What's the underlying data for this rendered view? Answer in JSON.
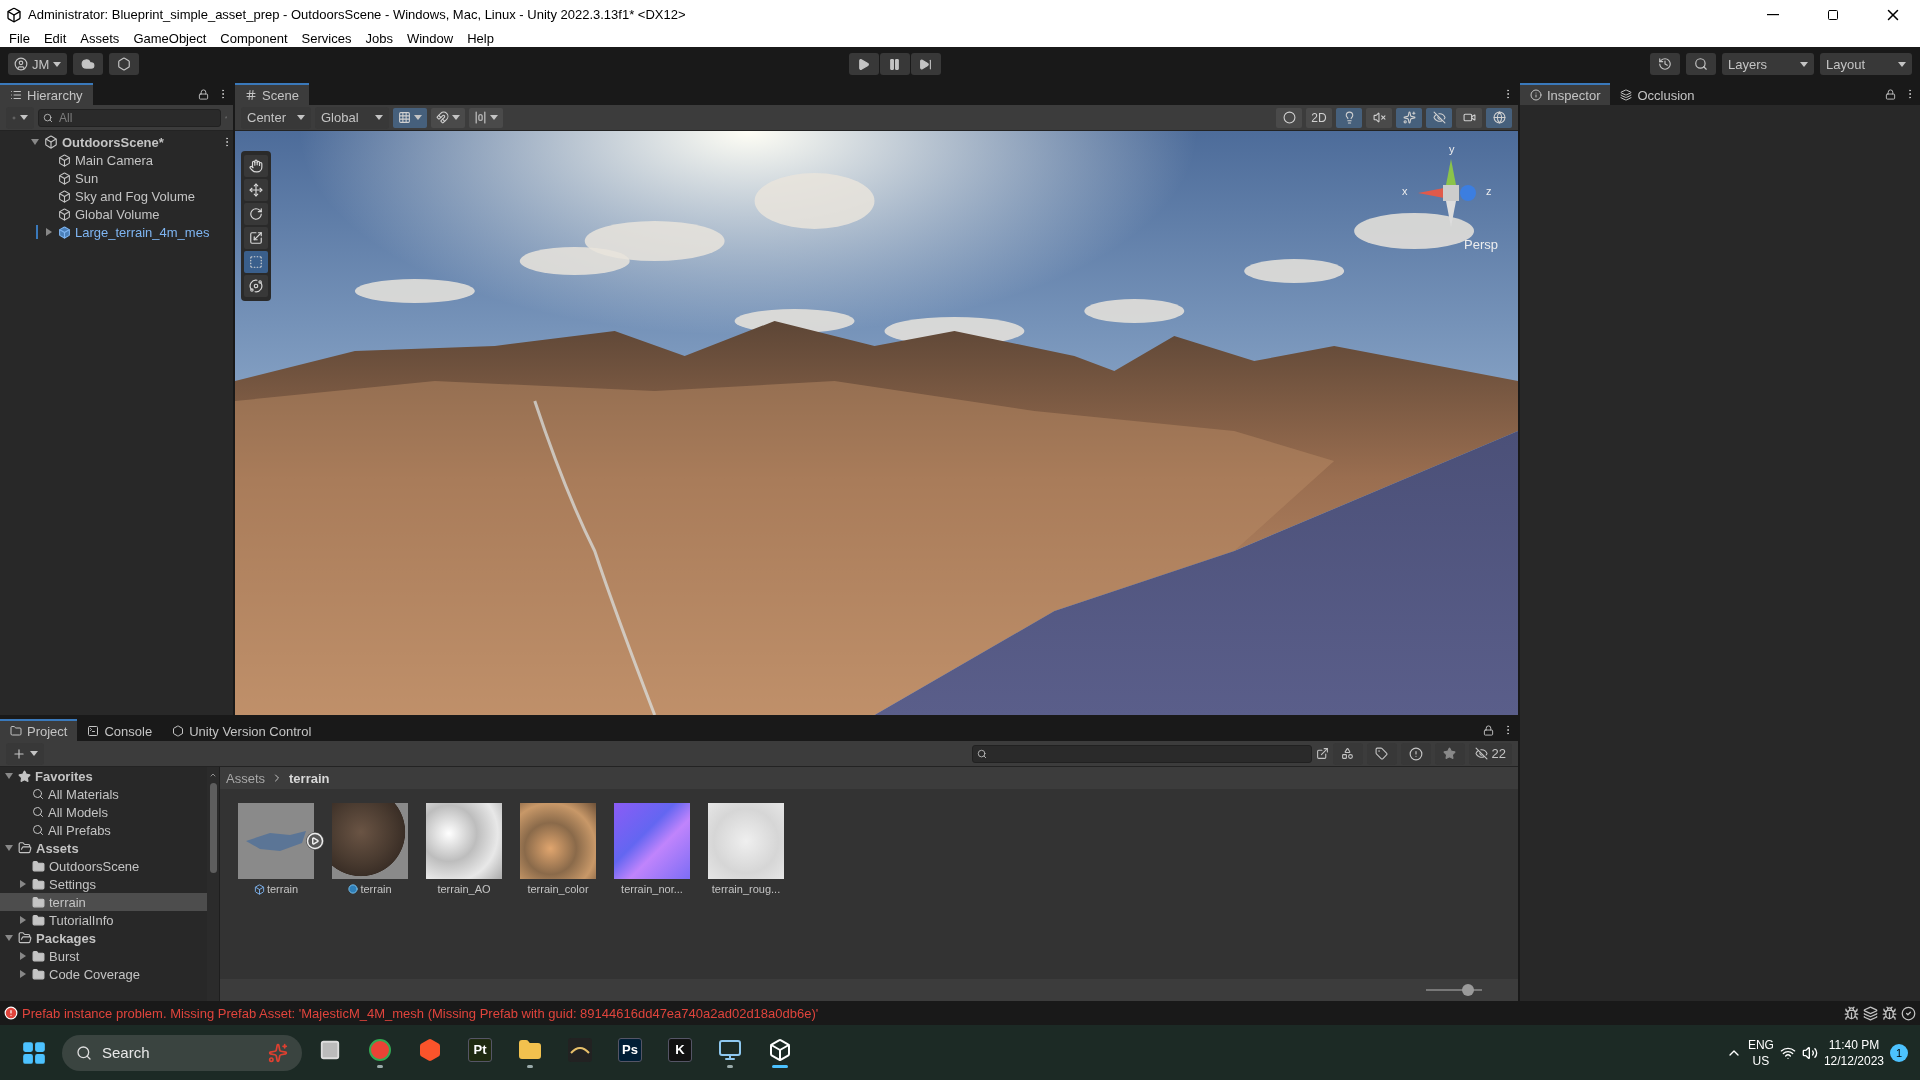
{
  "window": {
    "title": "Administrator: Blueprint_simple_asset_prep - OutdoorsScene - Windows, Mac, Linux - Unity 2022.3.13f1* <DX12>"
  },
  "menu": [
    "File",
    "Edit",
    "Assets",
    "GameObject",
    "Component",
    "Services",
    "Jobs",
    "Window",
    "Help"
  ],
  "toolbar": {
    "account": "JM",
    "layers": "Layers",
    "layout": "Layout"
  },
  "hierarchy": {
    "title": "Hierarchy",
    "search_placeholder": "All",
    "scene": {
      "name": "OutdoorsScene*",
      "expanded": true,
      "children": [
        {
          "label": "Main Camera",
          "kind": "object",
          "has_children": false
        },
        {
          "label": "Sun",
          "kind": "object",
          "has_children": false
        },
        {
          "label": "Sky and Fog Volume",
          "kind": "object",
          "has_children": false
        },
        {
          "label": "Global Volume",
          "kind": "object",
          "has_children": false
        },
        {
          "label": "Large_terrain_4m_mes",
          "kind": "prefab",
          "has_children": true
        }
      ]
    }
  },
  "scene_tabs": [
    {
      "label": "Scene",
      "selected": true
    }
  ],
  "scene_toolbar": {
    "pivot": "Center",
    "space": "Global",
    "snap_toggles": [
      {
        "kind": "grid-snap",
        "on": true
      },
      {
        "kind": "increment-snap",
        "on": false
      },
      {
        "kind": "align",
        "on": false
      }
    ],
    "view_toggles": [
      {
        "kind": "shading",
        "on": false
      },
      {
        "kind": "dimension",
        "label": "2D",
        "on": false
      },
      {
        "kind": "lighting",
        "on": true
      },
      {
        "kind": "audio",
        "on": false
      },
      {
        "kind": "effects",
        "on": true
      },
      {
        "kind": "visibility",
        "on": true
      },
      {
        "kind": "camera",
        "on": false
      },
      {
        "kind": "gizmos",
        "on": true
      }
    ]
  },
  "tools": [
    {
      "kind": "hand",
      "selected": false
    },
    {
      "kind": "move",
      "selected": false
    },
    {
      "kind": "rotate",
      "selected": false
    },
    {
      "kind": "scale",
      "selected": false
    },
    {
      "kind": "rect",
      "selected": true
    },
    {
      "kind": "transform",
      "selected": false
    }
  ],
  "gizmo": {
    "y": "y",
    "x": "x",
    "z": "z",
    "projection": "Persp"
  },
  "inspector_tabs": [
    {
      "label": "Inspector",
      "kind": "info",
      "selected": true
    },
    {
      "label": "Occlusion",
      "kind": "occlusion",
      "selected": false
    }
  ],
  "project_tabs": [
    {
      "label": "Project",
      "kind": "folder",
      "selected": true
    },
    {
      "label": "Console",
      "kind": "console",
      "selected": false
    },
    {
      "label": "Unity Version Control",
      "kind": "vcs",
      "selected": false
    }
  ],
  "project_tree": [
    {
      "label": "Favorites",
      "kind": "favorites",
      "expanded": true,
      "children": [
        {
          "label": "All Materials",
          "kind": "search",
          "has_children": false,
          "selected": false
        },
        {
          "label": "All Models",
          "kind": "search",
          "has_children": false,
          "selected": false
        },
        {
          "label": "All Prefabs",
          "kind": "search",
          "has_children": false,
          "selected": false
        }
      ]
    },
    {
      "label": "Assets",
      "kind": "folder",
      "expanded": true,
      "children": [
        {
          "label": "OutdoorsScene",
          "kind": "folder",
          "has_children": false,
          "selected": false
        },
        {
          "label": "Settings",
          "kind": "folder",
          "has_children": true,
          "selected": false
        },
        {
          "label": "terrain",
          "kind": "folder",
          "has_children": false,
          "selected": true
        },
        {
          "label": "TutorialInfo",
          "kind": "folder",
          "has_children": true,
          "selected": false
        }
      ]
    },
    {
      "label": "Packages",
      "kind": "folder",
      "expanded": true,
      "children": [
        {
          "label": "Burst",
          "kind": "folder",
          "has_children": true,
          "selected": false
        },
        {
          "label": "Code Coverage",
          "kind": "folder",
          "has_children": true,
          "selected": false
        }
      ]
    }
  ],
  "breadcrumb": [
    "Assets",
    "terrain"
  ],
  "assets": [
    {
      "label": "terrain",
      "kind": "mesh"
    },
    {
      "label": "terrain",
      "kind": "material"
    },
    {
      "label": "terrain_AO",
      "kind": "occlusion"
    },
    {
      "label": "terrain_color",
      "kind": "albedo"
    },
    {
      "label": "terrain_nor...",
      "kind": "normal"
    },
    {
      "label": "terrain_roug...",
      "kind": "roughness"
    }
  ],
  "hidden_count": "22",
  "thumb_size": {
    "level": 0.75
  },
  "status": {
    "message": "Prefab instance problem. Missing Prefab Asset: 'MajesticM_4M_mesh (Missing Prefab with guid: 89144616dd47ea740a2ad02d18a0db6e)'"
  },
  "taskbar": {
    "search_placeholder": "Search",
    "apps": [
      {
        "kind": "task-view",
        "running": false,
        "active": false
      },
      {
        "kind": "chrome",
        "running": true,
        "active": false
      },
      {
        "kind": "brave",
        "running": false,
        "active": false
      },
      {
        "kind": "tile",
        "label": "Pt",
        "color": "#1f2a10",
        "running": false,
        "active": false
      },
      {
        "kind": "files",
        "running": true,
        "active": false
      },
      {
        "kind": "arc",
        "running": false,
        "active": false
      },
      {
        "kind": "tile",
        "label": "Ps",
        "color": "#001e36",
        "running": false,
        "active": false
      },
      {
        "kind": "tile",
        "label": "K",
        "color": "#111111",
        "running": false,
        "active": false
      },
      {
        "kind": "remote",
        "running": true,
        "active": false
      },
      {
        "kind": "unity",
        "running": true,
        "active": true
      }
    ],
    "language": "ENG",
    "region": "US",
    "time": "11:40 PM",
    "date": "12/12/2023",
    "notifications": "1"
  }
}
